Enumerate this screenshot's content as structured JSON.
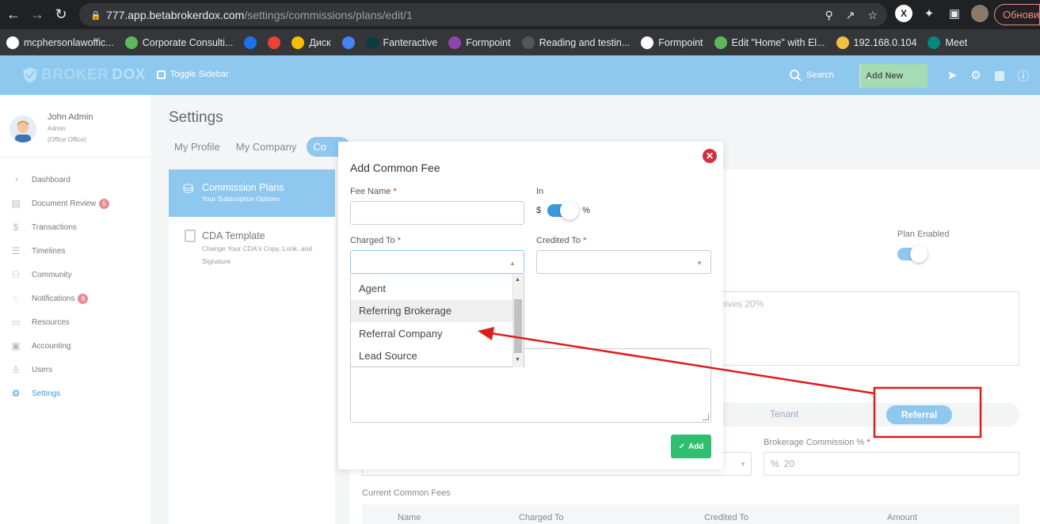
{
  "browser": {
    "url_host": "777.app.betabrokerdox.com",
    "url_path": "/settings/commissions/plans/edit/1",
    "update_label": "Обновить",
    "bookmarks": [
      {
        "label": "mcphersonlawoffic...",
        "icon_color": "#ffffff"
      },
      {
        "label": "Corporate Consulti...",
        "icon_color": "#5cb85c"
      },
      {
        "label": "",
        "icon_color": "#1a73e8"
      },
      {
        "label": "",
        "icon_color": "#ea4335"
      },
      {
        "label": "Диск",
        "icon_color": "#fbbc04"
      },
      {
        "label": "",
        "icon_color": "#4285f4"
      },
      {
        "label": "Fanteractive",
        "icon_color": "#0a3d3d"
      },
      {
        "label": "Formpoint",
        "icon_color": "#8e44ad"
      },
      {
        "label": "Reading and testin...",
        "icon_color": "#555555"
      },
      {
        "label": "Formpoint",
        "icon_color": "#ffffff"
      },
      {
        "label": "Edit \"Home\" with El...",
        "icon_color": "#5cb85c"
      },
      {
        "label": "192.168.0.104",
        "icon_color": "#f0c040"
      },
      {
        "label": "Meet",
        "icon_color": "#00897b"
      }
    ]
  },
  "header": {
    "logo_part1": "BROKER",
    "logo_part2": "DOX",
    "toggle_sidebar": "Toggle Sidebar",
    "search": "Search",
    "add_new": "Add New",
    "accent": "#8ec8ee"
  },
  "user": {
    "name": "John Admin",
    "role": "Admin",
    "office": "(Office Office)"
  },
  "menu": [
    {
      "label": "Dashboard",
      "icon": "dashboard-icon",
      "badge": ""
    },
    {
      "label": "Document Review",
      "icon": "document-icon",
      "badge": "5"
    },
    {
      "label": "Transactions",
      "icon": "dollar-icon",
      "badge": ""
    },
    {
      "label": "Timelines",
      "icon": "timeline-icon",
      "badge": ""
    },
    {
      "label": "Community",
      "icon": "community-icon",
      "badge": ""
    },
    {
      "label": "Notifications",
      "icon": "chat-icon",
      "badge": "6"
    },
    {
      "label": "Resources",
      "icon": "folder-icon",
      "badge": ""
    },
    {
      "label": "Accounting",
      "icon": "accounting-icon",
      "badge": ""
    },
    {
      "label": "Users",
      "icon": "user-icon",
      "badge": ""
    },
    {
      "label": "Settings",
      "icon": "gear-icon",
      "badge": ""
    }
  ],
  "settings": {
    "title": "Settings",
    "tabs": [
      "My Profile",
      "My Company",
      "Co"
    ],
    "left_items": [
      {
        "title": "Commission Plans",
        "subtitle": "Your Subscription Options"
      },
      {
        "title": "CDA Template",
        "subtitle": "Change Your CDA's Copy, Look, and Signature"
      }
    ],
    "plan_enabled": "Plan Enabled",
    "description_partial": "eives 20%",
    "type_tabs": {
      "tenant": "Tenant",
      "referral": "Referral"
    },
    "brokerage_commission_label": "Brokerage Commission %",
    "brokerage_commission_symbol": "%",
    "brokerage_commission_value": "20",
    "current_fees_label": "Current Common Fees",
    "fees_columns": [
      "Name",
      "Charged To",
      "Credited To",
      "Amount"
    ]
  },
  "modal": {
    "title": "Add Common Fee",
    "fee_name_label": "Fee Name",
    "in_label": "In",
    "in_left": "$",
    "in_right": "%",
    "charged_to_label": "Charged To",
    "credited_to_label": "Credited To",
    "required_mark": "*",
    "charged_options": [
      "Agent",
      "Referring Brokerage",
      "Referral Company",
      "Lead Source"
    ],
    "highlighted_option": "Referring Brokerage",
    "add_button": "Add"
  }
}
